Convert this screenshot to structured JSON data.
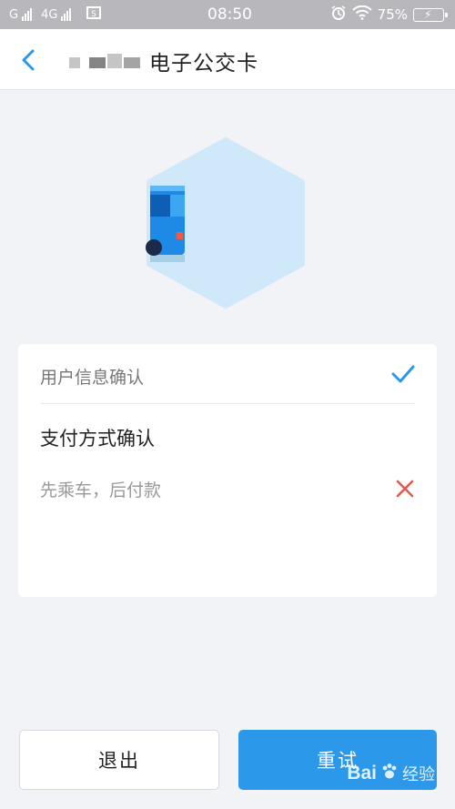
{
  "status_bar": {
    "carrier_1": "G",
    "carrier_2": "4G",
    "time": "08:50",
    "battery": "75%"
  },
  "header": {
    "title": "电子公交卡"
  },
  "card": {
    "row_user": {
      "label": "用户信息确认",
      "state": "check-icon",
      "state_color": "#2c98ea"
    },
    "row_payment": {
      "label": "支付方式确认"
    },
    "row_method": {
      "label": "先乘车，后付款",
      "state": "close-icon",
      "state_color": "#e05a4f"
    }
  },
  "buttons": {
    "exit_label": "退出",
    "retry_label": "重试"
  },
  "watermark": {
    "text": "Bai",
    "suffix": "经验"
  },
  "colors": {
    "accent": "#2c98ea",
    "error": "#e05a4f",
    "background": "#f2f3f7"
  }
}
